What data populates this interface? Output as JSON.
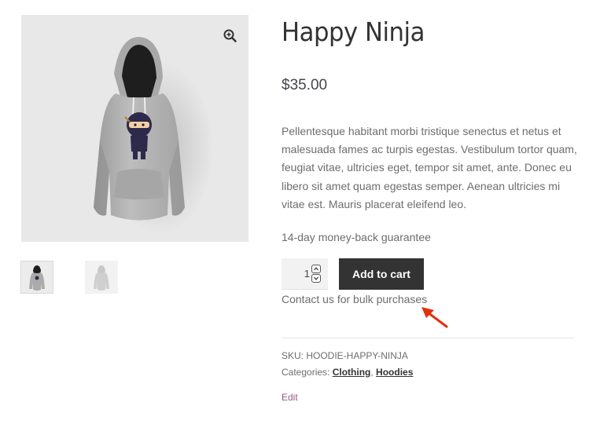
{
  "product": {
    "title": "Happy Ninja",
    "price": "$35.00",
    "description": "Pellentesque habitant morbi tristique senectus et netus et malesuada fames ac turpis egestas. Vestibulum tortor quam, feugiat vitae, ultricies eget, tempor sit amet, ante. Donec eu libero sit amet quam egestas semper. Aenean ultricies mi vitae est. Mauris placerat eleifend leo.",
    "guarantee": "14-day money-back guarantee",
    "quantity": "1",
    "add_to_cart_label": "Add to cart",
    "bulk_contact": "Contact us for bulk purchases",
    "sku_label": "SKU: ",
    "sku_value": "HOODIE-HAPPY-NINJA",
    "categories_label": "Categories: ",
    "categories": [
      "Clothing",
      "Hoodies"
    ],
    "category_separator": ", ",
    "edit_label": "Edit"
  },
  "gallery": {
    "main_image": "gray-hoodie-with-ninja-print",
    "thumbnails": [
      "hoodie-dark-hood-thumbnail",
      "hoodie-gray-thumbnail"
    ]
  },
  "icons": {
    "zoom": "zoom-in-magnifier-icon",
    "annotation": "red-arrow-icon"
  },
  "colors": {
    "button_bg": "#333333",
    "link": "#96588a",
    "annotation_arrow": "#e03010"
  }
}
